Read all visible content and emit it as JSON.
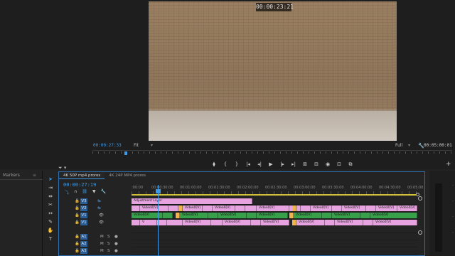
{
  "program_monitor": {
    "frame_timecode": "00:00:23:21",
    "current_timecode": "00:00:27:33",
    "fit_label": "Fit",
    "quality_label": "Full",
    "duration": "00:05:00:01",
    "transport": [
      "⧫",
      "{",
      "}",
      "|◂",
      "◂|",
      "▶",
      "|▸",
      "▸|",
      "⊞",
      "⊟",
      "◉",
      "⊡",
      "⧉"
    ]
  },
  "markers_panel": {
    "tab_label": "Markers"
  },
  "timeline": {
    "tabs": [
      "4K 50P mp4 prores",
      "4K 24P MP4 prores"
    ],
    "timecode": "00:00:27:19",
    "ruler_labels": [
      ":00:00",
      "00:00:30:00",
      "00:01:00:00",
      "00:01:30:00",
      "00:02:00:00",
      "00:02:30:00",
      "00:03:00:00",
      "00:03:30:00",
      "00:04:00:00",
      "00:04:30:00",
      "00:05:00"
    ],
    "tracks": [
      {
        "name": "V3",
        "kind": "video"
      },
      {
        "name": "V2",
        "kind": "video"
      },
      {
        "name": "V1",
        "kind": "video"
      },
      {
        "name": "V1",
        "kind": "video"
      },
      {
        "name": "A1",
        "kind": "audio"
      },
      {
        "name": "A2",
        "kind": "audio"
      },
      {
        "name": "A3",
        "kind": "audio"
      }
    ],
    "adjustment_clip_label": "Adjustment Layer",
    "clip_label": "Video0[V]",
    "clip_label_short": "V"
  },
  "colors": {
    "accent": "#3d9ae6",
    "clip_pink": "#e6a3df",
    "clip_green": "#36a04a",
    "work_area": "#d0c038"
  }
}
